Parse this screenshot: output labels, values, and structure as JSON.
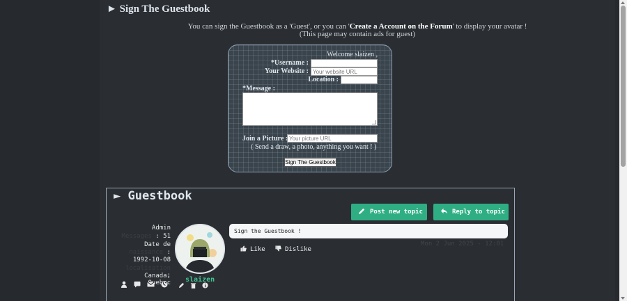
{
  "page": {
    "sign_title": "► Sign The Guestbook",
    "intro_prefix": "You can sign the Guestbook as a 'Guest', or you can '",
    "intro_link": "Create a Account on the Forum",
    "intro_suffix": "' to display your avatar !",
    "intro_line2": "(This page may contain ads for guest)"
  },
  "form": {
    "welcome": "Welcome slaizen ,",
    "username_label": "*Username :",
    "website_label": "Your Website :",
    "website_placeholder": "Your website URL",
    "location_label": "Location :",
    "message_label": "*Message :",
    "picture_label": "Join a Picture :",
    "picture_placeholder": "Your picture URL",
    "picture_hint": "( Send a draw, a photo, anything you want ! )",
    "submit_label": "Sign The Guestbook"
  },
  "guestbook": {
    "title": "► Guestbook",
    "post_new_topic": "Post new topic",
    "reply_to_topic": "Reply to topic",
    "post": {
      "role": "Admin",
      "messages_key": "Messages",
      "messages_value": "51",
      "birth_key1": "Date de",
      "birth_key2": "naissance",
      "birth_value": "1992-10-08",
      "location_key": "localisation",
      "location_value": "Canada, Quebec",
      "username": "slaizen",
      "message": "Sign the Guestbook !",
      "date": "Mon 2 Jun 2025 - 12:01",
      "like_label": "Like",
      "dislike_label": "Dislike"
    }
  },
  "colors": {
    "background": "#262a2f",
    "accent_green": "#2fae84",
    "username_green": "#3fc08e"
  }
}
